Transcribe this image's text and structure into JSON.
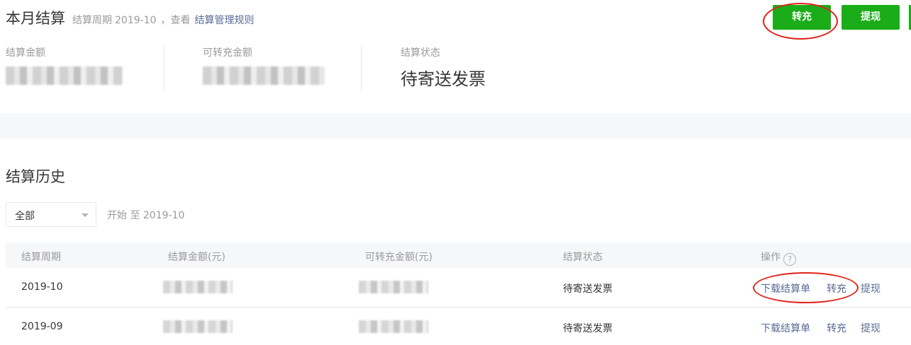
{
  "header": {
    "title": "本月结算",
    "period_label": "结算周期",
    "period_value": "2019-10",
    "separator": "，查看",
    "rules_link": "结算管理规则",
    "btn_transfer": "转充",
    "btn_withdraw": "提现"
  },
  "stats": {
    "settle_amount_label": "结算金额",
    "transferable_label": "可转充金额",
    "status_label": "结算状态",
    "status_value": "待寄送发票"
  },
  "history": {
    "title": "结算历史",
    "filter_selected": "全部",
    "range_text": "开始 至 2019-10",
    "columns": [
      "结算周期",
      "结算金额(元)",
      "可转充金额(元)",
      "结算状态",
      "操作"
    ],
    "rows": [
      {
        "period": "2019-10",
        "status": "待寄送发票",
        "actions": [
          "下载结算单",
          "转充",
          "提现"
        ]
      },
      {
        "period": "2019-09",
        "status": "待寄送发票",
        "actions": [
          "下载结算单",
          "转充",
          "提现"
        ]
      }
    ]
  },
  "icons": {
    "help": "question-circle-icon",
    "dropdown": "chevron-down-icon"
  },
  "colors": {
    "primary_green": "#1aad19",
    "link_blue": "#576b95",
    "annotation_red": "#e0221b"
  }
}
